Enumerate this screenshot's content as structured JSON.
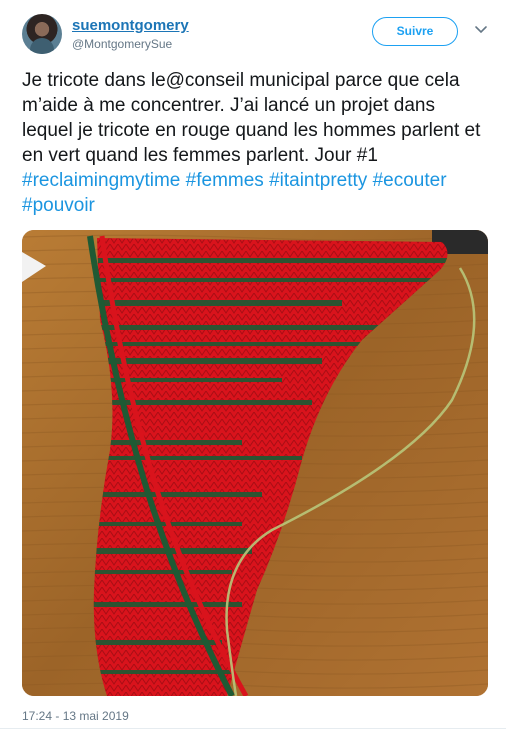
{
  "user": {
    "name": "suemontgomery",
    "handle": "@MontgomerySue"
  },
  "follow_label": "Suivre",
  "tweet": {
    "text": "Je tricote dans le@conseil municipal parce que cela m’aide à me concentrer. J’ai lancé un projet dans lequel je tricote en rouge quand les hommes parlent et en vert quand les femmes parlent. Jour #1 ",
    "hashtags": [
      "#reclaimingmytime",
      "#femmes",
      "#itaintpretty",
      "#ecouter",
      "#pouvoir"
    ]
  },
  "timestamp": "17:24 - 13 mai 2019",
  "colors": {
    "link": "#1b95e0",
    "follow_border": "#1da1f2",
    "knit_red": "#d9131c",
    "knit_green": "#1f5a34",
    "wood": "#a56a2a"
  },
  "icons": {
    "more": "chevron-down-icon"
  }
}
